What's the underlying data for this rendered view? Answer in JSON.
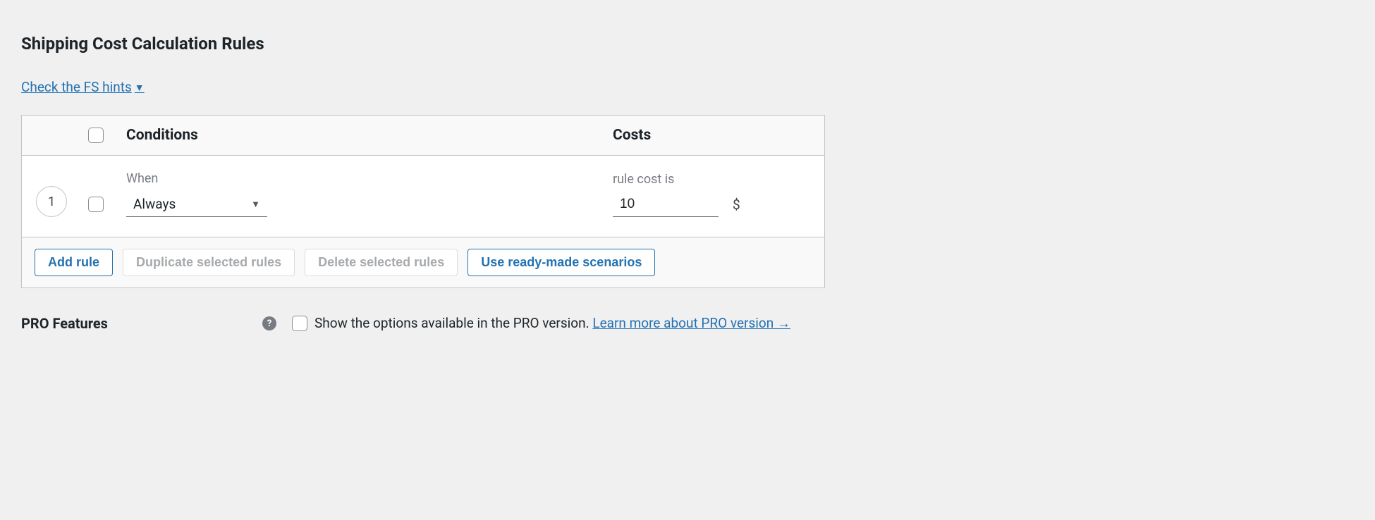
{
  "section_title": "Shipping Cost Calculation Rules",
  "hints_link_text": "Check the FS hints",
  "table": {
    "headers": {
      "conditions": "Conditions",
      "costs": "Costs"
    },
    "row": {
      "number": "1",
      "when_label": "When",
      "when_value": "Always",
      "cost_label": "rule cost is",
      "cost_value": "10",
      "currency": "$"
    },
    "footer": {
      "add_rule": "Add rule",
      "duplicate": "Duplicate selected rules",
      "delete": "Delete selected rules",
      "scenarios": "Use ready-made scenarios"
    }
  },
  "pro": {
    "label": "PRO Features",
    "help_glyph": "?",
    "checkbox_text": "Show the options available in the PRO version.",
    "link_text": "Learn more about PRO version →"
  }
}
